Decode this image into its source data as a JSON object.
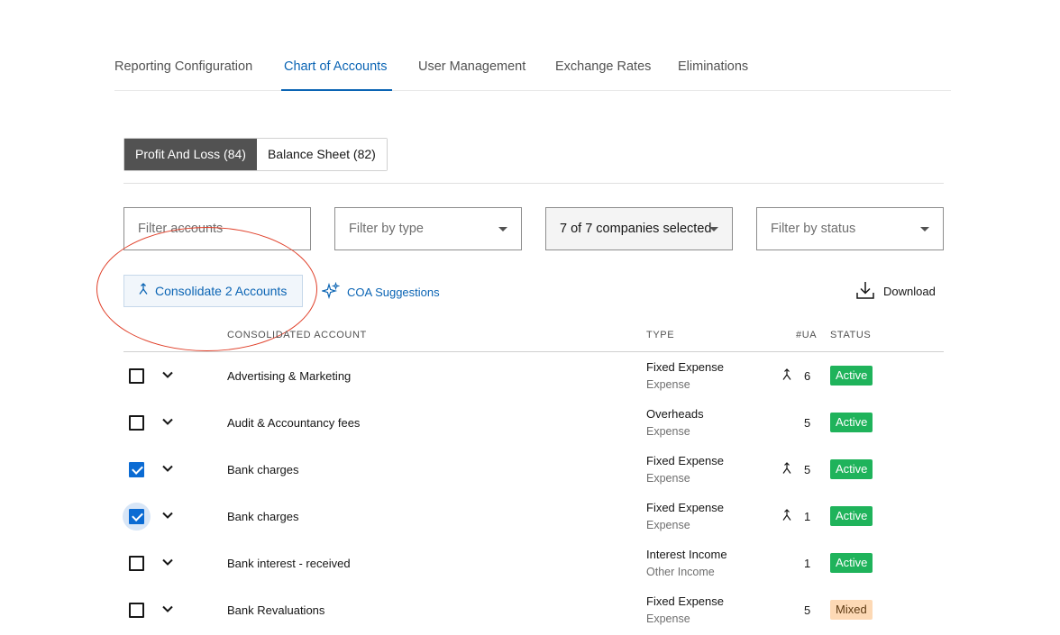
{
  "nav": {
    "tabs": [
      {
        "label": "Reporting Configuration"
      },
      {
        "label": "Chart of Accounts"
      },
      {
        "label": "User Management"
      },
      {
        "label": "Exchange Rates"
      },
      {
        "label": "Eliminations"
      }
    ],
    "active_tab": "Chart of Accounts"
  },
  "segments": {
    "profit_loss": "Profit And Loss (84)",
    "balance_sheet": "Balance Sheet (82)",
    "active": "profit_loss"
  },
  "filters": {
    "accounts_placeholder": "Filter accounts",
    "type_placeholder": "Filter by type",
    "companies_value": "7 of 7 companies selected",
    "status_placeholder": "Filter by status"
  },
  "actions": {
    "consolidate_label": "Consolidate 2 Accounts",
    "coa_label": "COA Suggestions",
    "download_label": "Download"
  },
  "table": {
    "headers": {
      "account": "CONSOLIDATED ACCOUNT",
      "type": "TYPE",
      "ua": "#UA",
      "status": "STATUS"
    },
    "rows": [
      {
        "checked": false,
        "account": "Advertising & Marketing",
        "type": "Fixed Expense",
        "subtype": "Expense",
        "merged": true,
        "ua": "6",
        "status": "Active"
      },
      {
        "checked": false,
        "account": "Audit & Accountancy fees",
        "type": "Overheads",
        "subtype": "Expense",
        "merged": false,
        "ua": "5",
        "status": "Active"
      },
      {
        "checked": true,
        "account": "Bank charges",
        "type": "Fixed Expense",
        "subtype": "Expense",
        "merged": true,
        "ua": "5",
        "status": "Active"
      },
      {
        "checked": true,
        "account": "Bank charges",
        "type": "Fixed Expense",
        "subtype": "Expense",
        "merged": true,
        "ua": "1",
        "status": "Active"
      },
      {
        "checked": false,
        "account": "Bank interest - received",
        "type": "Interest Income",
        "subtype": "Other Income",
        "merged": false,
        "ua": "1",
        "status": "Active"
      },
      {
        "checked": false,
        "account": "Bank Revaluations",
        "type": "Fixed Expense",
        "subtype": "Expense",
        "merged": false,
        "ua": "5",
        "status": "Mixed"
      }
    ]
  },
  "colors": {
    "accent": "#0a64b4",
    "active_status": "#1fb35b",
    "mixed_status": "#fdd9b5",
    "annotation": "#e0402a"
  }
}
